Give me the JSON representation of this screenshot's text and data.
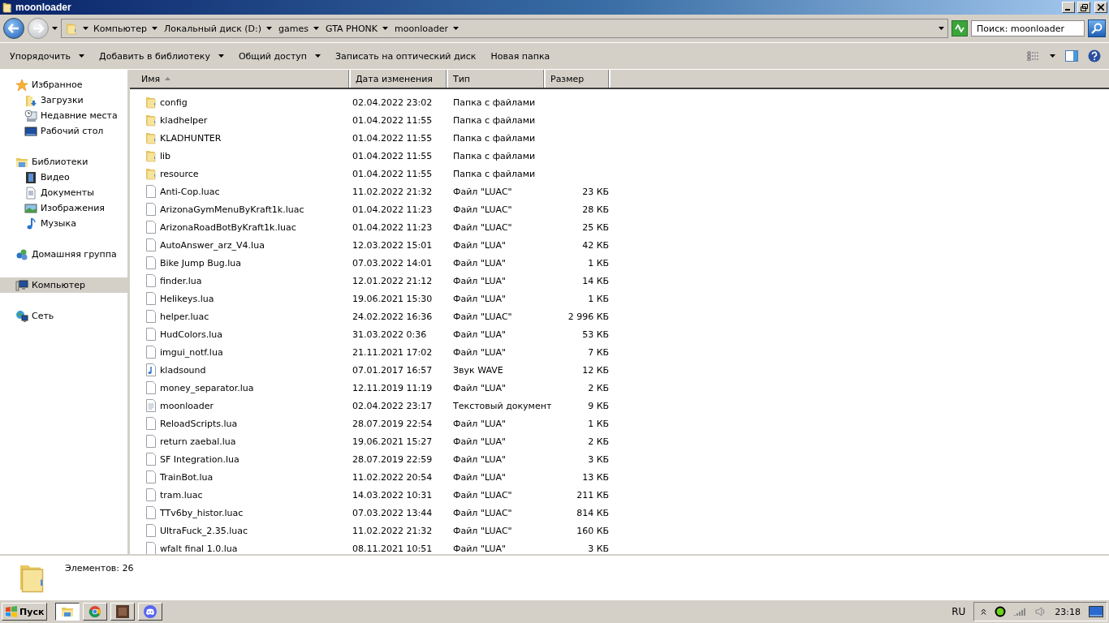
{
  "window": {
    "title": "moonloader"
  },
  "address": {
    "crumbs": [
      "Компьютер",
      "Локальный диск (D:)",
      "games",
      "GTA PHONK",
      "moonloader"
    ]
  },
  "search": {
    "placeholder": "Поиск: moonloader"
  },
  "toolbar": [
    {
      "label": "Упорядочить",
      "dropdown": true
    },
    {
      "label": "Добавить в библиотеку",
      "dropdown": true
    },
    {
      "label": "Общий доступ",
      "dropdown": true
    },
    {
      "label": "Записать на оптический диск",
      "dropdown": false
    },
    {
      "label": "Новая папка",
      "dropdown": false
    }
  ],
  "sidebar": [
    {
      "label": "Избранное",
      "kind": "star",
      "selected": false,
      "children": [
        {
          "label": "Загрузки",
          "kind": "downloads",
          "selected": false
        },
        {
          "label": "Недавние места",
          "kind": "recent",
          "selected": false
        },
        {
          "label": "Рабочий стол",
          "kind": "desktop",
          "selected": false
        }
      ]
    },
    {
      "label": "Библиотеки",
      "kind": "library",
      "selected": false,
      "children": [
        {
          "label": "Видео",
          "kind": "video",
          "selected": false
        },
        {
          "label": "Документы",
          "kind": "documents",
          "selected": false
        },
        {
          "label": "Изображения",
          "kind": "pictures",
          "selected": false
        },
        {
          "label": "Музыка",
          "kind": "music",
          "selected": false
        }
      ]
    },
    {
      "label": "Домашняя группа",
      "kind": "homegroup",
      "selected": false
    },
    {
      "label": "Компьютер",
      "kind": "computer",
      "selected": true
    },
    {
      "label": "Сеть",
      "kind": "network",
      "selected": false
    }
  ],
  "columns": [
    {
      "label": "Имя",
      "sorted": true
    },
    {
      "label": "Дата изменения",
      "sorted": false
    },
    {
      "label": "Тип",
      "sorted": false
    },
    {
      "label": "Размер",
      "sorted": false
    }
  ],
  "rows": [
    {
      "kind": "folder",
      "name": "config",
      "date": "02.04.2022 23:02",
      "type": "Папка с файлами"
    },
    {
      "kind": "folder",
      "name": "kladhelper",
      "date": "01.04.2022 11:55",
      "type": "Папка с файлами"
    },
    {
      "kind": "folder",
      "name": "KLADHUNTER",
      "date": "01.04.2022 11:55",
      "type": "Папка с файлами"
    },
    {
      "kind": "folder",
      "name": "lib",
      "date": "01.04.2022 11:55",
      "type": "Папка с файлами"
    },
    {
      "kind": "folder",
      "name": "resource",
      "date": "01.04.2022 11:55",
      "type": "Папка с файлами"
    },
    {
      "kind": "file",
      "name": "Anti-Cop.luac",
      "date": "11.02.2022 21:32",
      "type": "Файл \"LUAC\"",
      "size": "23 КБ"
    },
    {
      "kind": "file",
      "name": "ArizonaGymMenuByKraft1k.luac",
      "date": "01.04.2022 11:23",
      "type": "Файл \"LUAC\"",
      "size": "28 КБ"
    },
    {
      "kind": "file",
      "name": "ArizonaRoadBotByKraft1k.luac",
      "date": "01.04.2022 11:23",
      "type": "Файл \"LUAC\"",
      "size": "25 КБ"
    },
    {
      "kind": "file",
      "name": "AutoAnswer_arz_V4.lua",
      "date": "12.03.2022 15:01",
      "type": "Файл \"LUA\"",
      "size": "42 КБ"
    },
    {
      "kind": "file",
      "name": "Bike Jump Bug.lua",
      "date": "07.03.2022 14:01",
      "type": "Файл \"LUA\"",
      "size": "1 КБ"
    },
    {
      "kind": "file",
      "name": "finder.lua",
      "date": "12.01.2022 21:12",
      "type": "Файл \"LUA\"",
      "size": "14 КБ"
    },
    {
      "kind": "file",
      "name": "Helikeys.lua",
      "date": "19.06.2021 15:30",
      "type": "Файл \"LUA\"",
      "size": "1 КБ"
    },
    {
      "kind": "file",
      "name": "helper.luac",
      "date": "24.02.2022 16:36",
      "type": "Файл \"LUAC\"",
      "size": "2 996 КБ"
    },
    {
      "kind": "file",
      "name": "HudColors.lua",
      "date": "31.03.2022 0:36",
      "type": "Файл \"LUA\"",
      "size": "53 КБ"
    },
    {
      "kind": "file",
      "name": "imgui_notf.lua",
      "date": "21.11.2021 17:02",
      "type": "Файл \"LUA\"",
      "size": "7 КБ"
    },
    {
      "kind": "audio",
      "name": "kladsound",
      "date": "07.01.2017 16:57",
      "type": "Звук WAVE",
      "size": "12 КБ"
    },
    {
      "kind": "file",
      "name": "money_separator.lua",
      "date": "12.11.2019 11:19",
      "type": "Файл \"LUA\"",
      "size": "2 КБ"
    },
    {
      "kind": "text",
      "name": "moonloader",
      "date": "02.04.2022 23:17",
      "type": "Текстовый документ",
      "size": "9 КБ"
    },
    {
      "kind": "file",
      "name": "ReloadScripts.lua",
      "date": "28.07.2019 22:54",
      "type": "Файл \"LUA\"",
      "size": "1 КБ"
    },
    {
      "kind": "file",
      "name": "return zaebal.lua",
      "date": "19.06.2021 15:27",
      "type": "Файл \"LUA\"",
      "size": "2 КБ"
    },
    {
      "kind": "file",
      "name": "SF Integration.lua",
      "date": "28.07.2019 22:59",
      "type": "Файл \"LUA\"",
      "size": "3 КБ"
    },
    {
      "kind": "file",
      "name": "TrainBot.lua",
      "date": "11.02.2022 20:54",
      "type": "Файл \"LUA\"",
      "size": "13 КБ"
    },
    {
      "kind": "file",
      "name": "tram.luac",
      "date": "14.03.2022 10:31",
      "type": "Файл \"LUAC\"",
      "size": "211 КБ"
    },
    {
      "kind": "file",
      "name": "TTv6by_histor.luac",
      "date": "07.03.2022 13:44",
      "type": "Файл \"LUAC\"",
      "size": "814 КБ"
    },
    {
      "kind": "file",
      "name": "UltraFuck_2.35.luac",
      "date": "11.02.2022 21:32",
      "type": "Файл \"LUAC\"",
      "size": "160 КБ"
    },
    {
      "kind": "file",
      "name": "wfalt final 1.0.lua",
      "date": "08.11.2021 10:51",
      "type": "Файл \"LUA\"",
      "size": "3 КБ"
    }
  ],
  "details": {
    "text": "Элементов: 26"
  },
  "taskbar": {
    "start": "Пуск",
    "apps": [
      {
        "kind": "explorer",
        "selected": true
      },
      {
        "kind": "chrome",
        "selected": false
      },
      {
        "kind": "photo",
        "selected": false
      },
      {
        "kind": "discord",
        "selected": false
      }
    ],
    "lang": "RU",
    "clock": "23:18"
  }
}
